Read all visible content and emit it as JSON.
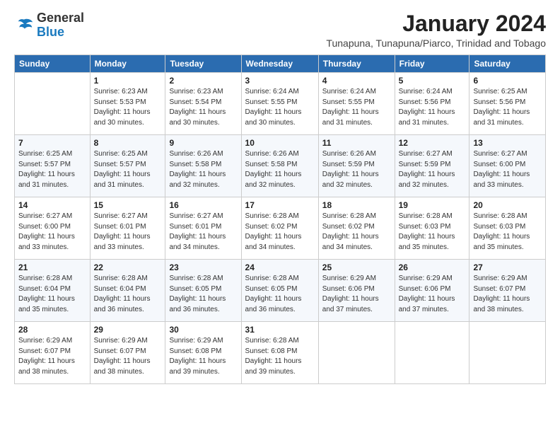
{
  "logo": {
    "general": "General",
    "blue": "Blue"
  },
  "title": "January 2024",
  "subtitle": "Tunapuna, Tunapuna/Piarco, Trinidad and Tobago",
  "header": {
    "days": [
      "Sunday",
      "Monday",
      "Tuesday",
      "Wednesday",
      "Thursday",
      "Friday",
      "Saturday"
    ]
  },
  "weeks": [
    [
      {
        "date": "",
        "info": ""
      },
      {
        "date": "1",
        "info": "Sunrise: 6:23 AM\nSunset: 5:53 PM\nDaylight: 11 hours\nand 30 minutes."
      },
      {
        "date": "2",
        "info": "Sunrise: 6:23 AM\nSunset: 5:54 PM\nDaylight: 11 hours\nand 30 minutes."
      },
      {
        "date": "3",
        "info": "Sunrise: 6:24 AM\nSunset: 5:55 PM\nDaylight: 11 hours\nand 30 minutes."
      },
      {
        "date": "4",
        "info": "Sunrise: 6:24 AM\nSunset: 5:55 PM\nDaylight: 11 hours\nand 31 minutes."
      },
      {
        "date": "5",
        "info": "Sunrise: 6:24 AM\nSunset: 5:56 PM\nDaylight: 11 hours\nand 31 minutes."
      },
      {
        "date": "6",
        "info": "Sunrise: 6:25 AM\nSunset: 5:56 PM\nDaylight: 11 hours\nand 31 minutes."
      }
    ],
    [
      {
        "date": "7",
        "info": "Sunrise: 6:25 AM\nSunset: 5:57 PM\nDaylight: 11 hours\nand 31 minutes."
      },
      {
        "date": "8",
        "info": "Sunrise: 6:25 AM\nSunset: 5:57 PM\nDaylight: 11 hours\nand 31 minutes."
      },
      {
        "date": "9",
        "info": "Sunrise: 6:26 AM\nSunset: 5:58 PM\nDaylight: 11 hours\nand 32 minutes."
      },
      {
        "date": "10",
        "info": "Sunrise: 6:26 AM\nSunset: 5:58 PM\nDaylight: 11 hours\nand 32 minutes."
      },
      {
        "date": "11",
        "info": "Sunrise: 6:26 AM\nSunset: 5:59 PM\nDaylight: 11 hours\nand 32 minutes."
      },
      {
        "date": "12",
        "info": "Sunrise: 6:27 AM\nSunset: 5:59 PM\nDaylight: 11 hours\nand 32 minutes."
      },
      {
        "date": "13",
        "info": "Sunrise: 6:27 AM\nSunset: 6:00 PM\nDaylight: 11 hours\nand 33 minutes."
      }
    ],
    [
      {
        "date": "14",
        "info": "Sunrise: 6:27 AM\nSunset: 6:00 PM\nDaylight: 11 hours\nand 33 minutes."
      },
      {
        "date": "15",
        "info": "Sunrise: 6:27 AM\nSunset: 6:01 PM\nDaylight: 11 hours\nand 33 minutes."
      },
      {
        "date": "16",
        "info": "Sunrise: 6:27 AM\nSunset: 6:01 PM\nDaylight: 11 hours\nand 34 minutes."
      },
      {
        "date": "17",
        "info": "Sunrise: 6:28 AM\nSunset: 6:02 PM\nDaylight: 11 hours\nand 34 minutes."
      },
      {
        "date": "18",
        "info": "Sunrise: 6:28 AM\nSunset: 6:02 PM\nDaylight: 11 hours\nand 34 minutes."
      },
      {
        "date": "19",
        "info": "Sunrise: 6:28 AM\nSunset: 6:03 PM\nDaylight: 11 hours\nand 35 minutes."
      },
      {
        "date": "20",
        "info": "Sunrise: 6:28 AM\nSunset: 6:03 PM\nDaylight: 11 hours\nand 35 minutes."
      }
    ],
    [
      {
        "date": "21",
        "info": "Sunrise: 6:28 AM\nSunset: 6:04 PM\nDaylight: 11 hours\nand 35 minutes."
      },
      {
        "date": "22",
        "info": "Sunrise: 6:28 AM\nSunset: 6:04 PM\nDaylight: 11 hours\nand 36 minutes."
      },
      {
        "date": "23",
        "info": "Sunrise: 6:28 AM\nSunset: 6:05 PM\nDaylight: 11 hours\nand 36 minutes."
      },
      {
        "date": "24",
        "info": "Sunrise: 6:28 AM\nSunset: 6:05 PM\nDaylight: 11 hours\nand 36 minutes."
      },
      {
        "date": "25",
        "info": "Sunrise: 6:29 AM\nSunset: 6:06 PM\nDaylight: 11 hours\nand 37 minutes."
      },
      {
        "date": "26",
        "info": "Sunrise: 6:29 AM\nSunset: 6:06 PM\nDaylight: 11 hours\nand 37 minutes."
      },
      {
        "date": "27",
        "info": "Sunrise: 6:29 AM\nSunset: 6:07 PM\nDaylight: 11 hours\nand 38 minutes."
      }
    ],
    [
      {
        "date": "28",
        "info": "Sunrise: 6:29 AM\nSunset: 6:07 PM\nDaylight: 11 hours\nand 38 minutes."
      },
      {
        "date": "29",
        "info": "Sunrise: 6:29 AM\nSunset: 6:07 PM\nDaylight: 11 hours\nand 38 minutes."
      },
      {
        "date": "30",
        "info": "Sunrise: 6:29 AM\nSunset: 6:08 PM\nDaylight: 11 hours\nand 39 minutes."
      },
      {
        "date": "31",
        "info": "Sunrise: 6:28 AM\nSunset: 6:08 PM\nDaylight: 11 hours\nand 39 minutes."
      },
      {
        "date": "",
        "info": ""
      },
      {
        "date": "",
        "info": ""
      },
      {
        "date": "",
        "info": ""
      }
    ]
  ]
}
